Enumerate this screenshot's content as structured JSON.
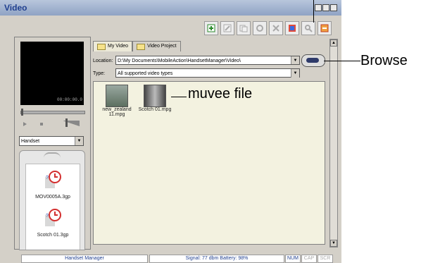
{
  "window": {
    "title": "Video"
  },
  "toolbar": {
    "buttons": [
      "add-icon",
      "edit-icon",
      "copy-icon",
      "refresh-icon",
      "delete-icon",
      "effects-icon",
      "browse-icon",
      "close-icon"
    ]
  },
  "player": {
    "timecode": "00:00:00.0"
  },
  "device_select": {
    "value": "Handset"
  },
  "handset_files": [
    {
      "name": "MOV0005A.3gp"
    },
    {
      "name": "Scotch 01.3gp"
    }
  ],
  "tabs": [
    {
      "label": "My Video"
    },
    {
      "label": "Video Project"
    }
  ],
  "location": {
    "label": "Location:",
    "value": "D:\\My Documents\\MobileAction\\HandsetManager\\Video\\"
  },
  "type": {
    "label": "Type:",
    "value": "All supported video types"
  },
  "files": [
    {
      "name": "new_zealand 11.mpg"
    },
    {
      "name": "Scotch 01.mpg"
    }
  ],
  "status": {
    "app": "Handset Manager",
    "signal": "Signal: 77 dbm Battery: 98%",
    "num": "NUM",
    "cap": "CAP",
    "scrl": "SCR"
  },
  "annotations": {
    "browse": "Browse",
    "muvee": "muvee file"
  }
}
